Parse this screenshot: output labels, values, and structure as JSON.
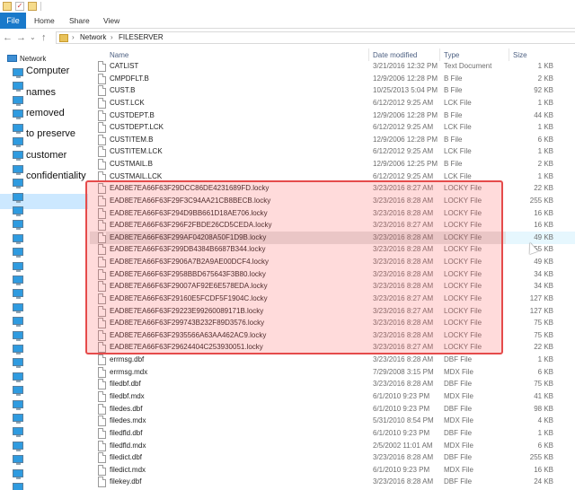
{
  "ribbon": {
    "file": "File",
    "tabs": [
      "Home",
      "Share",
      "View"
    ]
  },
  "address": {
    "crumbs": [
      "Network",
      "FILESERVER"
    ]
  },
  "nav": {
    "network_label": "Network",
    "overlay_words": [
      "Computer",
      "names",
      "removed",
      "to preserve",
      "customer",
      "confidentiality"
    ]
  },
  "columns": {
    "name": "Name",
    "date": "Date modified",
    "type": "Type",
    "size": "Size"
  },
  "files": [
    {
      "name": "CATLIST",
      "date": "3/21/2016 12:32 PM",
      "type": "Text Document",
      "size": "1 KB"
    },
    {
      "name": "CMPDFLT.B",
      "date": "12/9/2006 12:28 PM",
      "type": "B File",
      "size": "2 KB"
    },
    {
      "name": "CUST.B",
      "date": "10/25/2013 5:04 PM",
      "type": "B File",
      "size": "92 KB"
    },
    {
      "name": "CUST.LCK",
      "date": "6/12/2012 9:25 AM",
      "type": "LCK File",
      "size": "1 KB"
    },
    {
      "name": "CUSTDEPT.B",
      "date": "12/9/2006 12:28 PM",
      "type": "B File",
      "size": "44 KB"
    },
    {
      "name": "CUSTDEPT.LCK",
      "date": "6/12/2012 9:25 AM",
      "type": "LCK File",
      "size": "1 KB"
    },
    {
      "name": "CUSTITEM.B",
      "date": "12/9/2006 12:28 PM",
      "type": "B File",
      "size": "6 KB"
    },
    {
      "name": "CUSTITEM.LCK",
      "date": "6/12/2012 9:25 AM",
      "type": "LCK File",
      "size": "1 KB"
    },
    {
      "name": "CUSTMAIL.B",
      "date": "12/9/2006 12:25 PM",
      "type": "B File",
      "size": "2 KB"
    },
    {
      "name": "CUSTMAIL.LCK",
      "date": "6/12/2012 9:25 AM",
      "type": "LCK File",
      "size": "1 KB"
    },
    {
      "name": "EAD8E7EA66F63F29DCC86DE4231689FD.locky",
      "date": "3/23/2016 8:27 AM",
      "type": "LOCKY File",
      "size": "22 KB"
    },
    {
      "name": "EAD8E7EA66F63F29F3C94AA21CB8BECB.locky",
      "date": "3/23/2016 8:28 AM",
      "type": "LOCKY File",
      "size": "255 KB"
    },
    {
      "name": "EAD8E7EA66F63F294D9BB661D18AE706.locky",
      "date": "3/23/2016 8:28 AM",
      "type": "LOCKY File",
      "size": "16 KB"
    },
    {
      "name": "EAD8E7EA66F63F296F2FBDE26CD5CEDA.locky",
      "date": "3/23/2016 8:27 AM",
      "type": "LOCKY File",
      "size": "16 KB"
    },
    {
      "name": "EAD8E7EA66F63F299AF04208A50F1D9B.locky",
      "date": "3/23/2016 8:28 AM",
      "type": "LOCKY File",
      "size": "49 KB"
    },
    {
      "name": "EAD8E7EA66F63F299DB4384B6687B344.locky",
      "date": "3/23/2016 8:28 AM",
      "type": "LOCKY File",
      "size": "255 KB"
    },
    {
      "name": "EAD8E7EA66F63F2906A7B2A9AE00DCF4.locky",
      "date": "3/23/2016 8:28 AM",
      "type": "LOCKY File",
      "size": "49 KB"
    },
    {
      "name": "EAD8E7EA66F63F2958BBD675643F3B80.locky",
      "date": "3/23/2016 8:28 AM",
      "type": "LOCKY File",
      "size": "34 KB"
    },
    {
      "name": "EAD8E7EA66F63F29007AF92E6E578EDA.locky",
      "date": "3/23/2016 8:28 AM",
      "type": "LOCKY File",
      "size": "34 KB"
    },
    {
      "name": "EAD8E7EA66F63F29160E5FCDF5F1904C.locky",
      "date": "3/23/2016 8:27 AM",
      "type": "LOCKY File",
      "size": "127 KB"
    },
    {
      "name": "EAD8E7EA66F63F29223E99260089171B.locky",
      "date": "3/23/2016 8:27 AM",
      "type": "LOCKY File",
      "size": "127 KB"
    },
    {
      "name": "EAD8E7EA66F63F299743B232F89D3576.locky",
      "date": "3/23/2016 8:28 AM",
      "type": "LOCKY File",
      "size": "75 KB"
    },
    {
      "name": "EAD8E7EA66F63F2935566A63AA462AC9.locky",
      "date": "3/23/2016 8:28 AM",
      "type": "LOCKY File",
      "size": "75 KB"
    },
    {
      "name": "EAD8E7EA66F63F29624404C253930051.locky",
      "date": "3/23/2016 8:27 AM",
      "type": "LOCKY File",
      "size": "22 KB"
    },
    {
      "name": "errmsg.dbf",
      "date": "3/23/2016 8:28 AM",
      "type": "DBF File",
      "size": "1 KB"
    },
    {
      "name": "errmsg.mdx",
      "date": "7/29/2008 3:15 PM",
      "type": "MDX File",
      "size": "6 KB"
    },
    {
      "name": "filedbf.dbf",
      "date": "3/23/2016 8:28 AM",
      "type": "DBF File",
      "size": "75 KB"
    },
    {
      "name": "filedbf.mdx",
      "date": "6/1/2010 9:23 PM",
      "type": "MDX File",
      "size": "41 KB"
    },
    {
      "name": "filedes.dbf",
      "date": "6/1/2010 9:23 PM",
      "type": "DBF File",
      "size": "98 KB"
    },
    {
      "name": "filedes.mdx",
      "date": "5/31/2010 8:54 PM",
      "type": "MDX File",
      "size": "4 KB"
    },
    {
      "name": "filedfld.dbf",
      "date": "6/1/2010 9:23 PM",
      "type": "DBF File",
      "size": "1 KB"
    },
    {
      "name": "filedfld.mdx",
      "date": "2/5/2002 11:01 AM",
      "type": "MDX File",
      "size": "6 KB"
    },
    {
      "name": "filedict.dbf",
      "date": "3/23/2016 8:28 AM",
      "type": "DBF File",
      "size": "255 KB"
    },
    {
      "name": "filedict.mdx",
      "date": "6/1/2010 9:23 PM",
      "type": "MDX File",
      "size": "16 KB"
    },
    {
      "name": "filekey.dbf",
      "date": "3/23/2016 8:28 AM",
      "type": "DBF File",
      "size": "24 KB"
    }
  ]
}
